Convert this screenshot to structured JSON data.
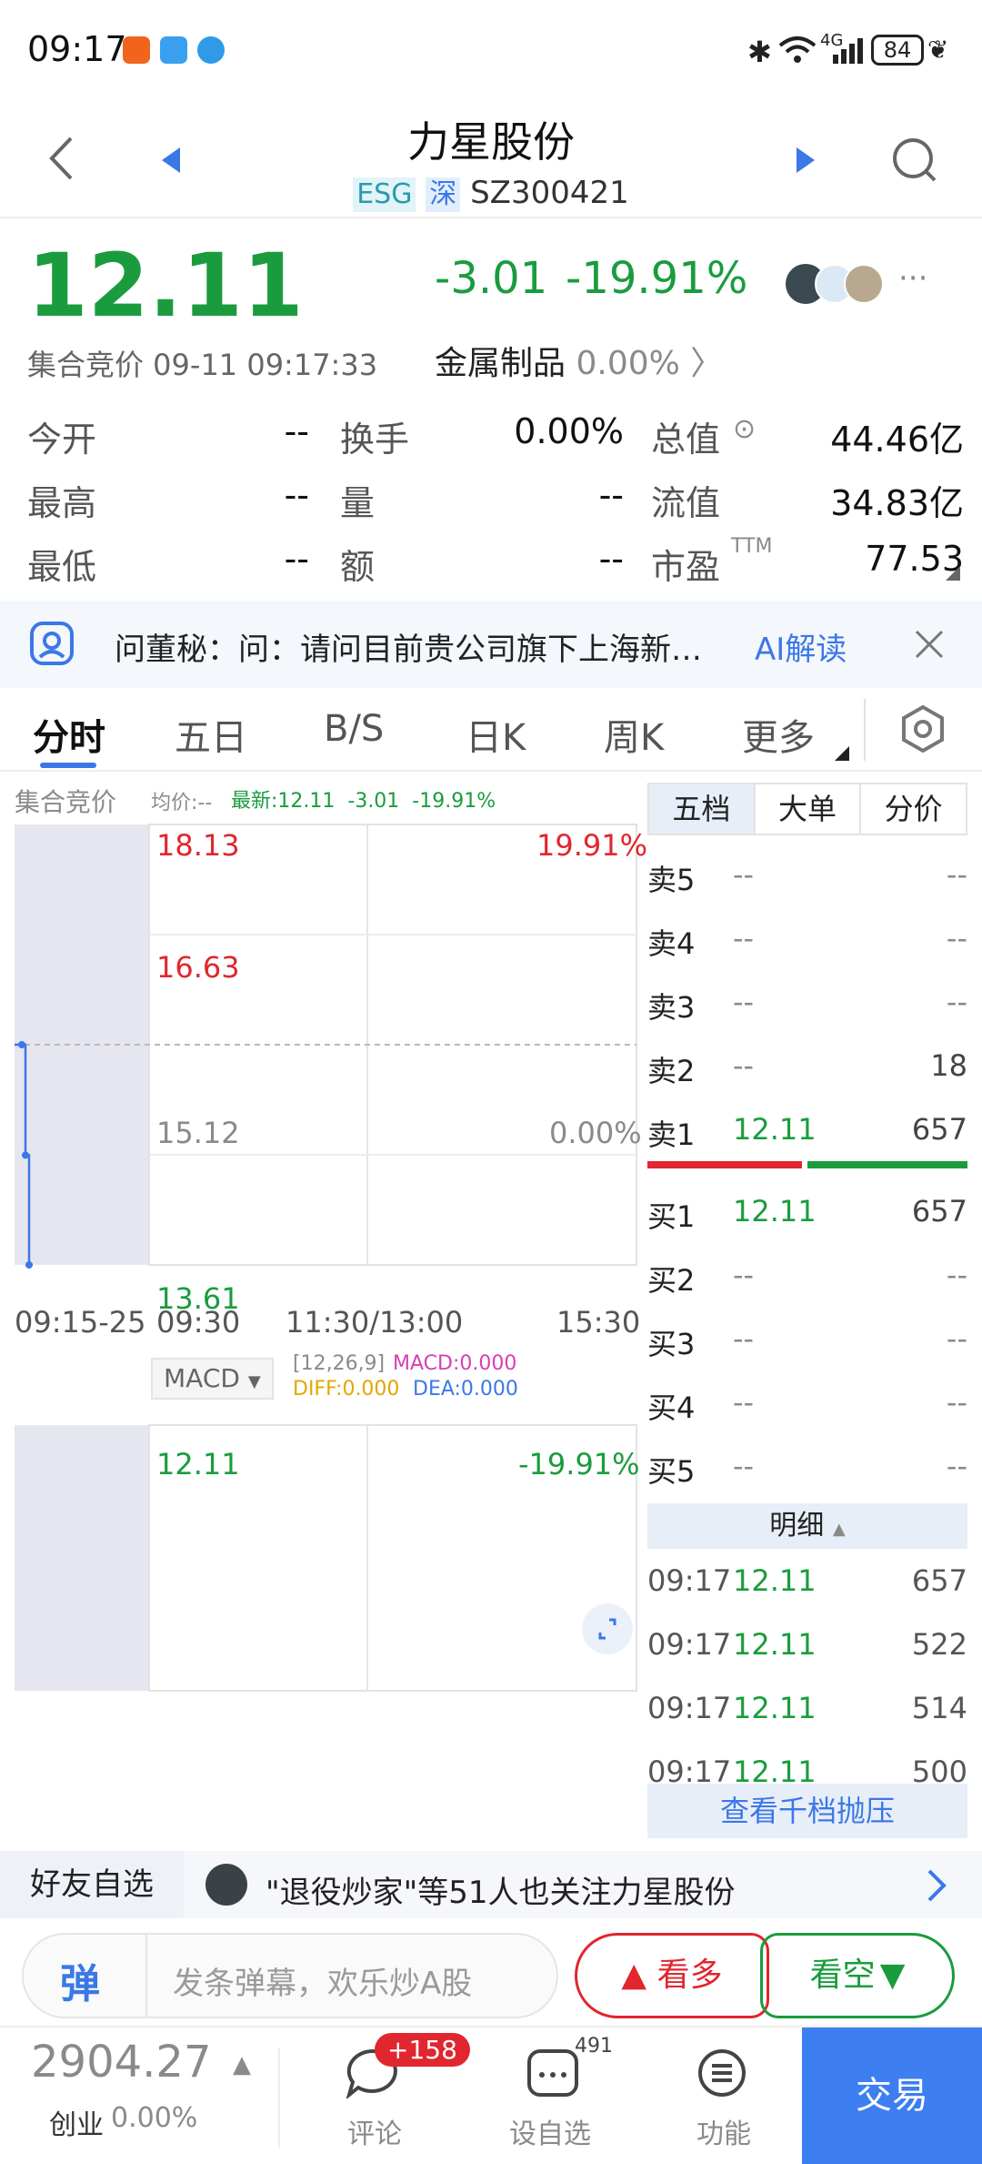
{
  "status_bar": {
    "time": "09:17",
    "battery": "84",
    "network": "4G"
  },
  "header": {
    "title": "力星股份",
    "tag_esg": "ESG",
    "tag_market": "深",
    "code": "SZ300421"
  },
  "quote": {
    "price": "12.11",
    "change": "-3.01",
    "change_pct": "-19.91%",
    "status": "集合竞价 09-11 09:17:33",
    "industry": "金属制品",
    "industry_pct": "0.00%",
    "stats": [
      {
        "label": "今开",
        "value": "--"
      },
      {
        "label": "换手",
        "value": "0.00%"
      },
      {
        "label": "总值",
        "value": "44.46亿"
      },
      {
        "label": "最高",
        "value": "--"
      },
      {
        "label": "量",
        "value": "--"
      },
      {
        "label": "流值",
        "value": "34.83亿"
      },
      {
        "label": "最低",
        "value": "--"
      },
      {
        "label": "额",
        "value": "--"
      },
      {
        "label": "市盈",
        "value": "77.53"
      }
    ],
    "pe_suffix": "TTM"
  },
  "ai_bar": {
    "text": "问董秘：问：请问目前贵公司旗下上海新…",
    "action": "AI解读"
  },
  "tabs": [
    "分时",
    "五日",
    "B/S",
    "日K",
    "周K",
    "更多"
  ],
  "chart": {
    "auction_label": "集合竞价",
    "avg_label": "均价:--",
    "latest_label": "最新:12.11  -3.01  -19.91%",
    "price_ticks": [
      "18.13",
      "16.63",
      "15.12",
      "13.61",
      "12.11"
    ],
    "pct_ticks": [
      "19.91%",
      "0.00%",
      "-19.91%"
    ],
    "time_ticks": [
      "09:15-25",
      "09:30",
      "11:30/13:00",
      "15:30"
    ],
    "macd_button": "MACD",
    "macd_params": "[12,26,9]",
    "macd_value": "MACD:0.000",
    "diff_value": "DIFF:0.000",
    "dea_value": "DEA:0.000"
  },
  "chart_data": {
    "type": "line",
    "title": "",
    "x": [
      "09:15",
      "09:17",
      "09:17",
      "09:17:33"
    ],
    "y": [
      15.12,
      15.12,
      13.61,
      12.11
    ],
    "ylim": [
      12.11,
      18.13
    ],
    "xlabel": "",
    "ylabel": ""
  },
  "order_book": {
    "tabs": [
      "五档",
      "大单",
      "分价"
    ],
    "sells": [
      {
        "label": "卖5",
        "price": "--",
        "vol": "--"
      },
      {
        "label": "卖4",
        "price": "--",
        "vol": "--"
      },
      {
        "label": "卖3",
        "price": "--",
        "vol": "--"
      },
      {
        "label": "卖2",
        "price": "--",
        "vol": "18"
      },
      {
        "label": "卖1",
        "price": "12.11",
        "vol": "657"
      }
    ],
    "buys": [
      {
        "label": "买1",
        "price": "12.11",
        "vol": "657"
      },
      {
        "label": "买2",
        "price": "--",
        "vol": "--"
      },
      {
        "label": "买3",
        "price": "--",
        "vol": "--"
      },
      {
        "label": "买4",
        "price": "--",
        "vol": "--"
      },
      {
        "label": "买5",
        "price": "--",
        "vol": "--"
      }
    ],
    "detail_header": "明细",
    "details": [
      {
        "time": "09:17",
        "price": "12.11",
        "vol": "657"
      },
      {
        "time": "09:17",
        "price": "12.11",
        "vol": "522"
      },
      {
        "time": "09:17",
        "price": "12.11",
        "vol": "514"
      },
      {
        "time": "09:17",
        "price": "12.11",
        "vol": "500"
      }
    ],
    "depth_button": "查看千档抛压"
  },
  "friend_bar": {
    "label": "好友自选",
    "text": "\"退役炒家\"等51人也关注力星股份"
  },
  "input_bar": {
    "danmu_icon": "弹",
    "placeholder": "发条弹幕，欢乐炒A股",
    "bull": "看多",
    "bear": "看空"
  },
  "nav": {
    "index_value": "2904.27",
    "index_name": "创业",
    "index_pct": "0.00%",
    "comment_label": "评论",
    "comment_badge": "+158",
    "watch_label": "设自选",
    "watch_badge": "491",
    "func_label": "功能",
    "trade_label": "交易"
  },
  "colors": {
    "up": "#e0262f",
    "down": "#1a9c3e",
    "accent": "#3b78e7"
  }
}
